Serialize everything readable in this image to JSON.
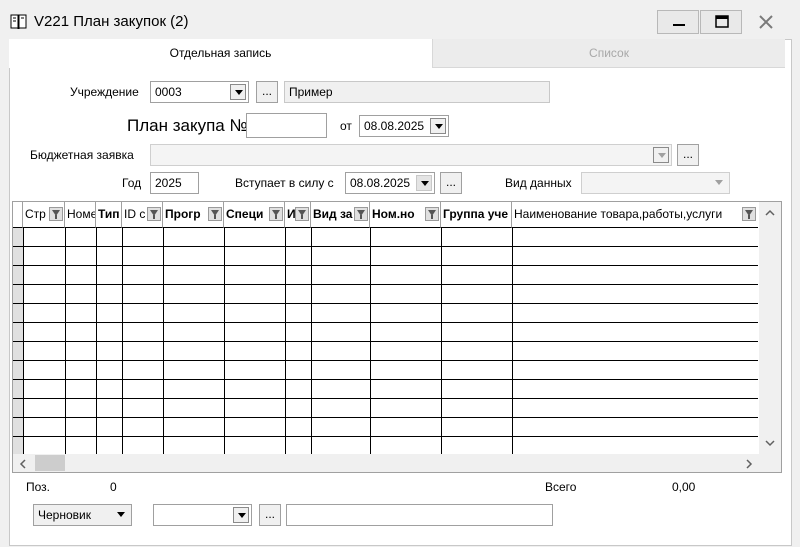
{
  "window": {
    "title": "V221 План закупок (2)",
    "icon": "book-icon"
  },
  "tabs": [
    {
      "label": "Отдельная запись",
      "active": true
    },
    {
      "label": "Список",
      "active": false
    }
  ],
  "form": {
    "institution_label": "Учреждение",
    "institution_code": "0003",
    "institution_name": "Пример",
    "plan_label": "План закупа №",
    "plan_number": "",
    "from_label": "от",
    "plan_date": "08.08.2025",
    "budget_label": "Бюджетная заявка",
    "budget_value": "",
    "year_label": "Год",
    "year_value": "2025",
    "effective_label": "Вступает в силу с",
    "effective_date": "08.08.2025",
    "datatype_label": "Вид данных",
    "datatype_value": "",
    "dots": "..."
  },
  "grid": {
    "columns": [
      "Стр",
      "Номе",
      "Тип",
      "ID с",
      "Прогр",
      "Специ",
      "И",
      "Вид за",
      "Ном.но",
      "Группа уче",
      "Наименование товара,работы,услуги"
    ],
    "row_count": 12
  },
  "footer": {
    "pos_label": "Поз.",
    "pos_value": "0",
    "total_label": "Всего",
    "total_value": "0,00",
    "status_value": "Черновик",
    "combo2_value": "",
    "text_value": "",
    "dots": "..."
  }
}
